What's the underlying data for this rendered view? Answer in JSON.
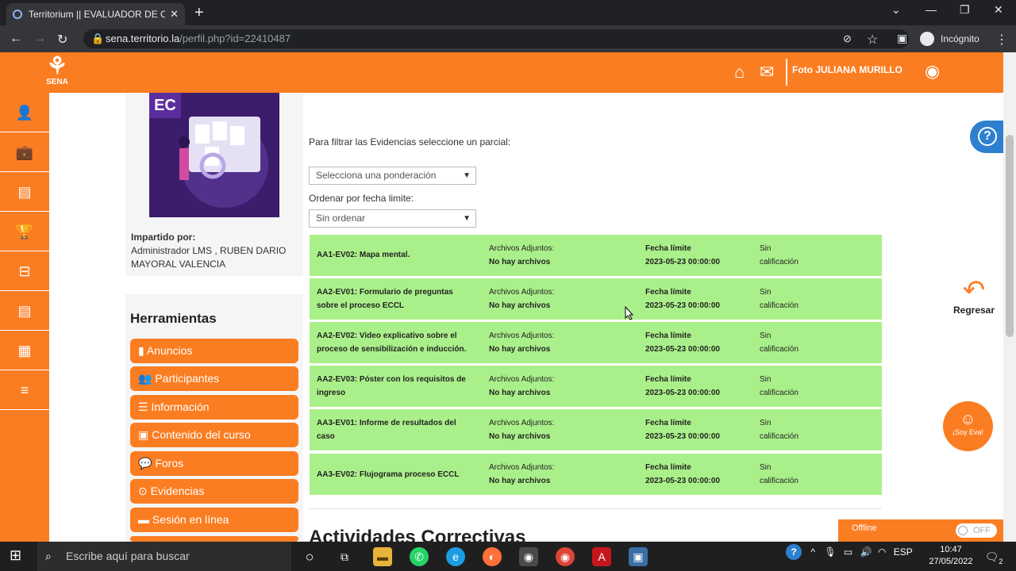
{
  "browser": {
    "tab_title": "Territorium || EVALUADOR DE CO",
    "tab_close": "✕",
    "new_tab": "+",
    "url_host": "sena.territorio.la",
    "url_path": "/perfil.php?id=22410487",
    "incognito_label": "Incógnito",
    "window_buttons": [
      "⌄",
      "—",
      "❐",
      "✕"
    ]
  },
  "header": {
    "logo_text": "SENA",
    "user_label": "Foto JULIANA MURILLO"
  },
  "course": {
    "image_badge": "EC",
    "imparted_label": "Impartido por:",
    "imparted_by": "Administrador LMS , RUBEN DARIO MAYORAL VALENCIA"
  },
  "tools": {
    "heading": "Herramientas",
    "items": [
      {
        "label": "Anuncios",
        "icon": "▮"
      },
      {
        "label": "Participantes",
        "icon": "👥"
      },
      {
        "label": "Información",
        "icon": "☰"
      },
      {
        "label": "Contenido del curso",
        "icon": "▣"
      },
      {
        "label": "Foros",
        "icon": "💬"
      },
      {
        "label": "Evidencias",
        "icon": "⊙"
      },
      {
        "label": "Sesión en línea",
        "icon": "▬"
      }
    ]
  },
  "filters": {
    "filter_label": "Para filtrar las Evidencias seleccione un parcial:",
    "ponderacion_value": "Selecciona una ponderación",
    "order_label": "Ordenar por fecha limite:",
    "order_value": "Sin ordenar"
  },
  "evidences": [
    {
      "name": "AA1-EV02: Mapa mental.",
      "att_label": "Archivos Adjuntos:",
      "att_value": "No hay archivos",
      "due_label": "Fecha límite",
      "due_value": "2023-05-23 00:00:00",
      "grade_1": "Sin",
      "grade_2": "calificación"
    },
    {
      "name": "AA2-EV01: Formulario de preguntas sobre el proceso ECCL",
      "att_label": "Archivos Adjuntos:",
      "att_value": "No hay archivos",
      "due_label": "Fecha límite",
      "due_value": "2023-05-23 00:00:00",
      "grade_1": "Sin",
      "grade_2": "calificación"
    },
    {
      "name": "AA2-EV02: Video explicativo sobre el proceso de sensibilización e inducción.",
      "att_label": "Archivos Adjuntos:",
      "att_value": "No hay archivos",
      "due_label": "Fecha límite",
      "due_value": "2023-05-23 00:00:00",
      "grade_1": "Sin",
      "grade_2": "calificación"
    },
    {
      "name": "AA2-EV03: Póster con los requisitos de ingreso",
      "att_label": "Archivos Adjuntos:",
      "att_value": "No hay archivos",
      "due_label": "Fecha límite",
      "due_value": "2023-05-23 00:00:00",
      "grade_1": "Sin",
      "grade_2": "calificación"
    },
    {
      "name": "AA3-EV01: Informe de resultados del caso",
      "att_label": "Archivos Adjuntos:",
      "att_value": "No hay archivos",
      "due_label": "Fecha límite",
      "due_value": "2023-05-23 00:00:00",
      "grade_1": "Sin",
      "grade_2": "calificación"
    },
    {
      "name": "AA3-EV02: Flujograma proceso ECCL",
      "att_label": "Archivos Adjuntos:",
      "att_value": "No hay archivos",
      "due_label": "Fecha límite",
      "due_value": "2023-05-23 00:00:00",
      "grade_1": "Sin",
      "grade_2": "calificación"
    }
  ],
  "corrective_heading": "Actividades Correctivas",
  "right": {
    "back_label": "Regresar",
    "eva_label": "¡Soy Eva!",
    "offline_label": "Offline",
    "toggle_label": "OFF"
  },
  "taskbar": {
    "search_placeholder": "Escribe aquí para buscar",
    "language": "ESP",
    "time": "10:47",
    "date": "27/05/2022",
    "notifications": "2"
  },
  "colors": {
    "brand": "#fb7d22",
    "row_green": "#aaf08a"
  }
}
